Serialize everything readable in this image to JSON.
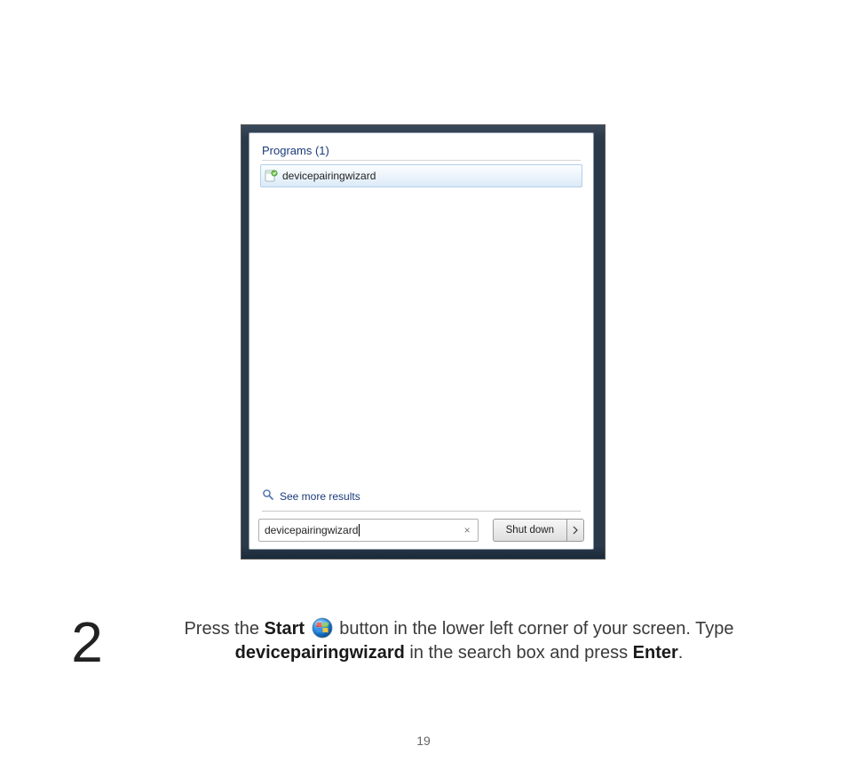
{
  "start_menu": {
    "programs_header": "Programs (1)",
    "result_label": "devicepairingwizard",
    "see_more_label": "See more results",
    "search_value": "devicepairingwizard",
    "shutdown_label": "Shut down"
  },
  "instruction": {
    "step_number": "2",
    "text_1": "Press the ",
    "bold_start": "Start",
    "text_2": " button in the lower left corner of your screen. Type ",
    "bold_query": "devicepairingwizard",
    "text_3": " in the search box and press ",
    "bold_enter": "Enter",
    "text_4": "."
  },
  "page_number": "19"
}
